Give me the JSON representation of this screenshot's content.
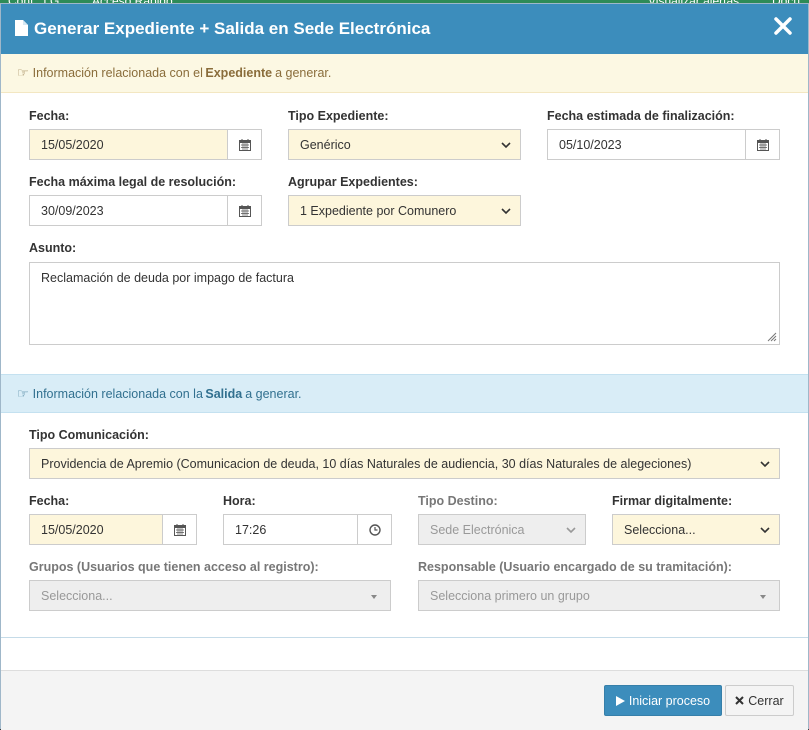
{
  "background": {
    "left_text": "Conf.: LG",
    "center_text": "Acceso Rápido",
    "right_text_1": "Visualizar alertas",
    "right_text_2": "Docu"
  },
  "modal": {
    "title": "Generar Expediente + Salida en Sede Electrónica",
    "close_label": "×"
  },
  "expediente_alert": {
    "prefix": "Información relacionada con el ",
    "strong": "Expediente",
    "suffix": " a generar."
  },
  "expediente": {
    "fecha": {
      "label": "Fecha:",
      "value": "15/05/2020"
    },
    "tipo": {
      "label": "Tipo Expediente:",
      "value": "Genérico"
    },
    "fecha_estimada": {
      "label": "Fecha estimada de finalización:",
      "value": "05/10/2023"
    },
    "fecha_maxima": {
      "label": "Fecha máxima legal de resolución:",
      "value": "30/09/2023"
    },
    "agrupar": {
      "label": "Agrupar Expedientes:",
      "value": "1 Expediente por Comunero"
    },
    "asunto": {
      "label": "Asunto:",
      "value": "Reclamación de deuda por impago de factura"
    }
  },
  "salida_alert": {
    "prefix": "Información relacionada con la ",
    "strong": "Salida",
    "suffix": " a generar."
  },
  "salida": {
    "tipo_comunicacion": {
      "label": "Tipo Comunicación:",
      "value": "Providencia de Apremio (Comunicacion de deuda, 10 días Naturales de audiencia, 30 días Naturales de alegeciones)"
    },
    "fecha": {
      "label": "Fecha:",
      "value": "15/05/2020"
    },
    "hora": {
      "label": "Hora:",
      "value": "17:26"
    },
    "tipo_destino": {
      "label": "Tipo Destino:",
      "value": "Sede Electrónica"
    },
    "firmar": {
      "label": "Firmar digitalmente:",
      "value": "Selecciona..."
    },
    "grupos": {
      "label": "Grupos (Usuarios que tienen acceso al registro):",
      "value": "Selecciona..."
    },
    "responsable": {
      "label": "Responsable (Usuario encargado de su tramitación):",
      "value": "Selecciona primero un grupo"
    }
  },
  "footer": {
    "start_label": "Iniciar proceso",
    "close_label": "Cerrar"
  },
  "colors": {
    "header": "#3c8dbc",
    "warning_bg": "#fcf8e3",
    "info_bg": "#d9edf7",
    "field_highlight": "#fdf6dc"
  }
}
